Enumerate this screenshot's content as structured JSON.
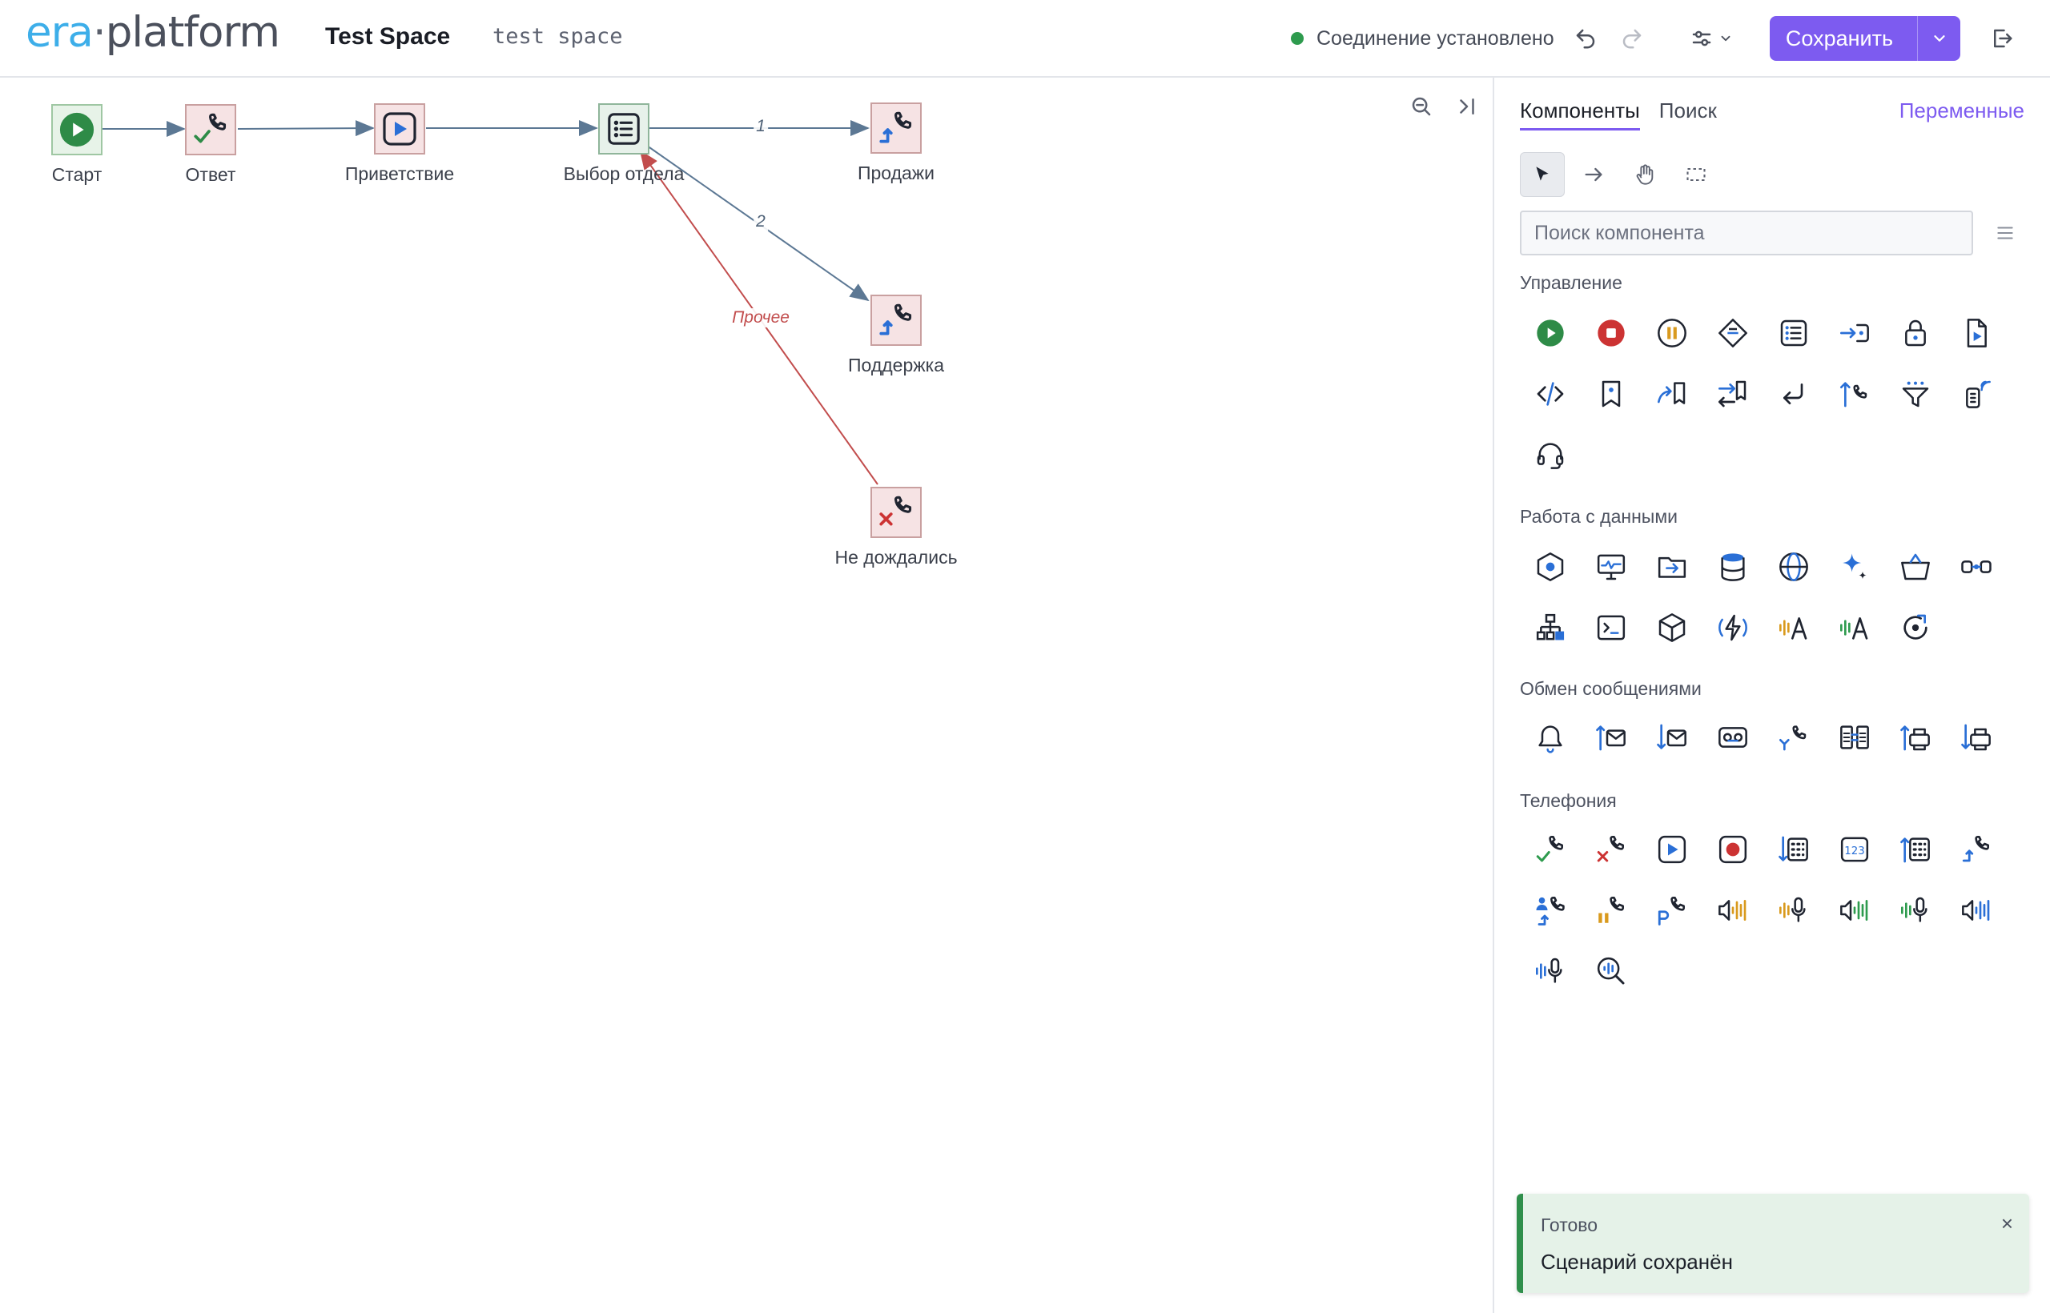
{
  "header": {
    "logo_left": "era",
    "logo_dot": "·",
    "logo_right": "platform",
    "project_name": "Test Space",
    "project_description": "test space",
    "connection_status": "Соединение установлено",
    "save_label": "Сохранить",
    "icons": [
      "undo-icon",
      "redo-icon",
      "settings-sliders-icon",
      "chevron-down-icon",
      "logout-icon"
    ],
    "colors": {
      "accent": "#7d5bf0",
      "connected": "#2e9b4e"
    }
  },
  "canvas": {
    "nodes": [
      {
        "id": "start",
        "label": "Старт",
        "icon": "play-circle-icon"
      },
      {
        "id": "answer",
        "label": "Ответ",
        "icon": "call-answer-icon"
      },
      {
        "id": "greeting",
        "label": "Приветствие",
        "icon": "play-media-icon"
      },
      {
        "id": "menu",
        "label": "Выбор отдела",
        "icon": "list-menu-icon"
      },
      {
        "id": "sales",
        "label": "Продажи",
        "icon": "call-transfer-icon"
      },
      {
        "id": "support",
        "label": "Поддержка",
        "icon": "call-transfer-icon"
      },
      {
        "id": "noanswer",
        "label": "Не дождались",
        "icon": "call-hangup-icon"
      }
    ],
    "edges": [
      {
        "from": "start",
        "to": "answer",
        "label": ""
      },
      {
        "from": "answer",
        "to": "greeting",
        "label": ""
      },
      {
        "from": "greeting",
        "to": "menu",
        "label": ""
      },
      {
        "from": "menu",
        "to": "sales",
        "label": "1"
      },
      {
        "from": "menu",
        "to": "support",
        "label": "2"
      },
      {
        "from": "menu",
        "to": "noanswer",
        "label": "Прочее"
      }
    ],
    "tools": [
      "zoom-out-icon",
      "collapse-panel-icon"
    ]
  },
  "panel": {
    "tabs": [
      {
        "label": "Компоненты",
        "active": true
      },
      {
        "label": "Поиск",
        "active": false
      }
    ],
    "variables_tab": "Переменные",
    "tools": [
      "pointer-icon",
      "arrow-connect-icon",
      "hand-pan-icon",
      "select-rect-icon"
    ],
    "search_placeholder": "Поиск компонента",
    "sections": [
      {
        "title": "Управление",
        "icons": [
          "start-icon",
          "stop-icon",
          "pause-icon",
          "condition-icon",
          "menu-list-icon",
          "goto-icon",
          "lock-icon",
          "script-file-icon",
          "code-icon",
          "bookmark-icon",
          "jump-bookmark-icon",
          "switch-bookmark-icon",
          "return-icon",
          "call-out-icon",
          "filter-icon",
          "remote-control-icon",
          "headset-icon"
        ]
      },
      {
        "title": "Работа с данными",
        "icons": [
          "hexagon-icon",
          "monitor-icon",
          "folder-icon",
          "database-icon",
          "globe-icon",
          "ai-sparkle-icon",
          "basket-icon",
          "link-icon",
          "hierarchy-icon",
          "terminal-icon",
          "cube-icon",
          "lightning-icon",
          "asr-text-orange-icon",
          "asr-text-green-icon",
          "refresh-target-icon"
        ]
      },
      {
        "title": "Обмен сообщениями",
        "icons": [
          "bell-icon",
          "mail-send-icon",
          "mail-receive-icon",
          "voicemail-icon",
          "callback-icon",
          "bridge-icon",
          "fax-send-icon",
          "fax-receive-icon"
        ]
      },
      {
        "title": "Телефония",
        "icons": [
          "call-answer-icon",
          "call-hangup-icon",
          "play-media-icon",
          "record-icon",
          "dtmf-in-icon",
          "digits-icon",
          "dtmf-out-icon",
          "call-transfer-icon",
          "user-transfer-icon",
          "call-hold-icon",
          "call-park-icon",
          "speaker-orange-icon",
          "mic-orange-icon",
          "speaker-green-icon",
          "mic-green-icon",
          "speaker-blue-icon",
          "mic-blue-icon",
          "voice-search-icon"
        ]
      }
    ]
  },
  "toast": {
    "title": "Готово",
    "message": "Сценарий сохранён",
    "close": "×"
  }
}
